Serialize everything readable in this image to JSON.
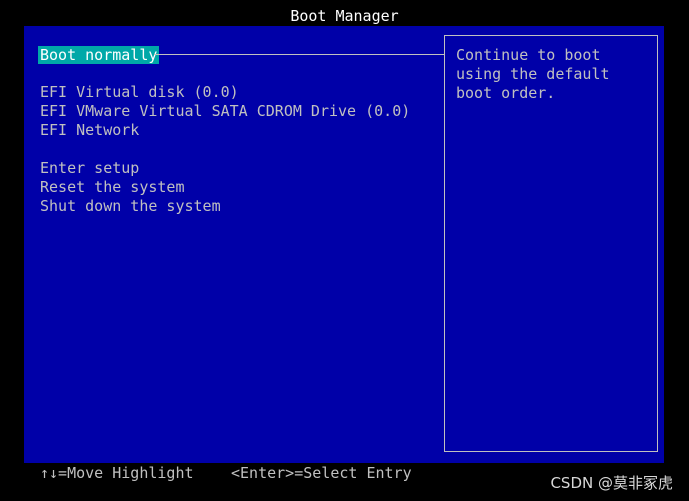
{
  "header": {
    "title": "Boot Manager"
  },
  "menu": {
    "items": [
      {
        "label": "Boot normally",
        "selected": true
      },
      {
        "label": "EFI Virtual disk (0.0)"
      },
      {
        "label": "EFI VMware Virtual SATA CDROM Drive (0.0)"
      },
      {
        "label": "EFI Network"
      },
      {
        "label": "Enter setup"
      },
      {
        "label": "Reset the system"
      },
      {
        "label": "Shut down the system"
      }
    ]
  },
  "help": {
    "text": "Continue to boot using the default boot order."
  },
  "footer": {
    "move_hint": "↑↓=Move Highlight",
    "select_hint": "<Enter>=Select Entry"
  },
  "watermark": "CSDN @莫非冢虎",
  "colors": {
    "background": "#0000a8",
    "selection": "#00a8a8",
    "text": "#c0c0c0",
    "title": "#ffffff"
  }
}
